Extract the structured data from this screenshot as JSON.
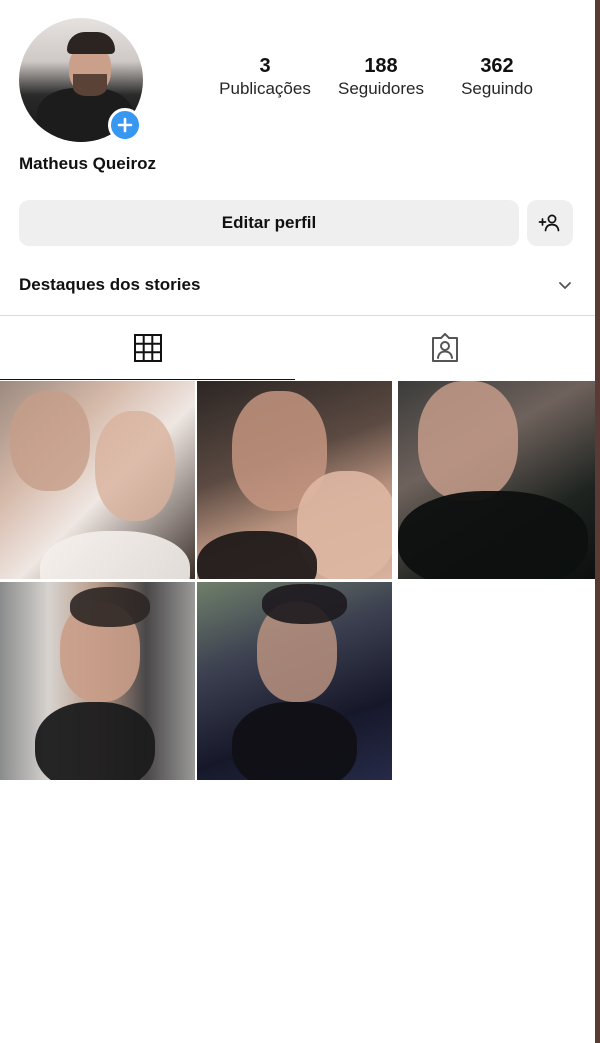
{
  "profile": {
    "name": "Matheus Queiroz",
    "stats": {
      "posts_count": "3",
      "posts_label": "Publicações",
      "followers_count": "188",
      "followers_label": "Seguidores",
      "following_count": "362",
      "following_label": "Seguindo"
    }
  },
  "actions": {
    "edit_profile_label": "Editar perfil",
    "discover_people_icon": "add-person-icon"
  },
  "highlights": {
    "label": "Destaques dos stories",
    "icon": "chevron-down-icon"
  },
  "tabs": [
    {
      "icon": "grid-icon",
      "active": true
    },
    {
      "icon": "tagged-icon",
      "active": false
    }
  ],
  "posts": [
    {
      "index": 1
    },
    {
      "index": 2
    },
    {
      "index": 3
    },
    {
      "index": 4
    },
    {
      "index": 5
    }
  ],
  "colors": {
    "accent_blue": "#3897f0",
    "button_bg": "#efefef",
    "divider": "#dbdbdb"
  }
}
